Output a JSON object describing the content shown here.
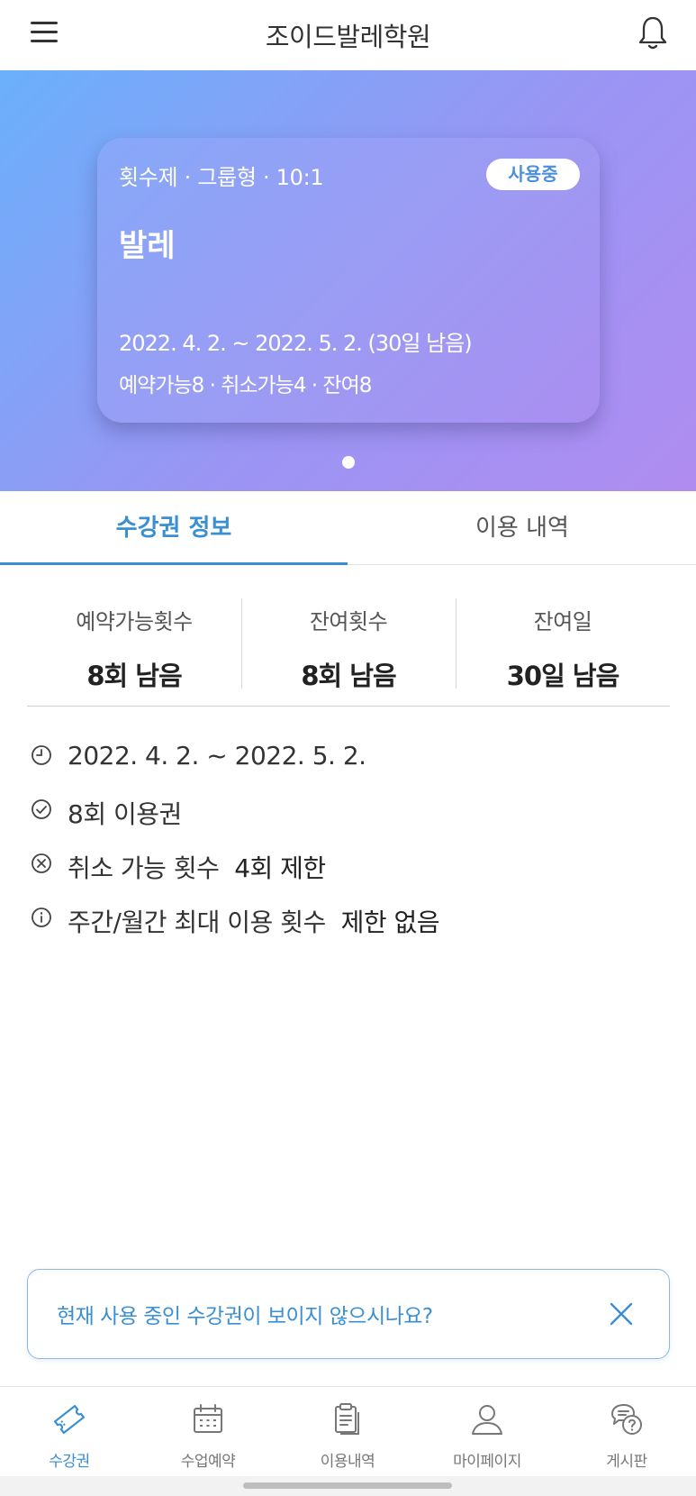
{
  "header": {
    "title": "조이드발레학원",
    "menu_icon": "hamburger-menu-icon",
    "bell_icon": "bell-icon"
  },
  "pass_card": {
    "meta": "횟수제 · 그룹형 · 10:1",
    "status_badge": "사용중",
    "title": "발레",
    "period": "2022. 4. 2. ~ 2022. 5. 2. (30일 남음)",
    "counts": "예약가능8 · 취소가능4 · 잔여8"
  },
  "tabs": [
    {
      "label": "수강권 정보",
      "active": true
    },
    {
      "label": "이용 내역",
      "active": false
    }
  ],
  "stats": [
    {
      "label": "예약가능횟수",
      "value": "8회 남음"
    },
    {
      "label": "잔여횟수",
      "value": "8회 남음"
    },
    {
      "label": "잔여일",
      "value": "30일 남음"
    }
  ],
  "info": {
    "period": "2022. 4. 2. ~ 2022. 5. 2.",
    "pass_type": "8회 이용권",
    "cancel_label": "취소 가능 횟수",
    "cancel_value": "4회 제한",
    "usage_label": "주간/월간 최대 이용 횟수",
    "usage_value": "제한 없음"
  },
  "notice": {
    "text": "현재 사용 중인 수강권이 보이지 않으시나요?"
  },
  "bottom_nav": [
    {
      "label": "수강권",
      "icon": "ticket-icon",
      "active": true
    },
    {
      "label": "수업예약",
      "icon": "calendar-icon",
      "active": false
    },
    {
      "label": "이용내역",
      "icon": "clipboard-icon",
      "active": false
    },
    {
      "label": "마이페이지",
      "icon": "user-icon",
      "active": false
    },
    {
      "label": "게시판",
      "icon": "chat-question-icon",
      "active": false
    }
  ],
  "colors": {
    "accent": "#3a8fd3",
    "hero_start": "#6ab0fb",
    "hero_end": "#b08cf0"
  }
}
